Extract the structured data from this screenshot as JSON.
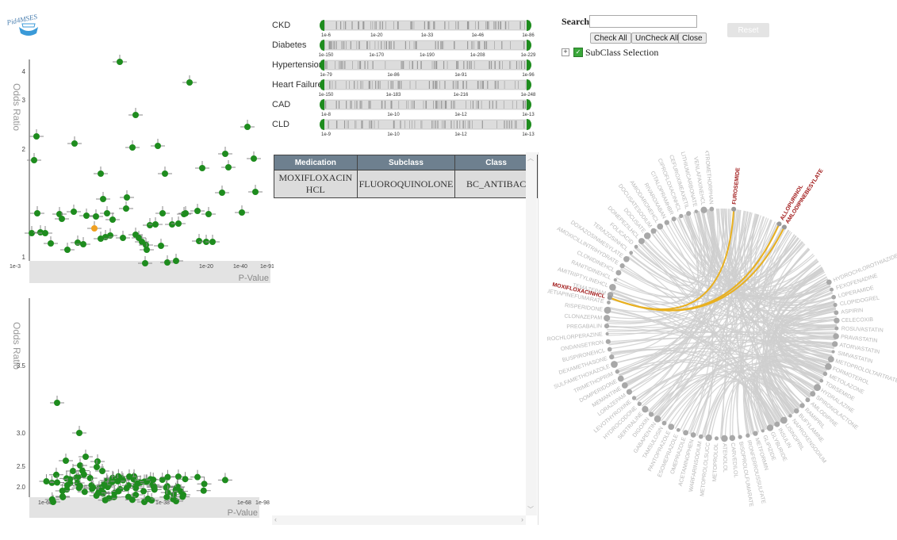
{
  "app": {
    "logo_text": "Pid4MSES"
  },
  "scatter_top": {
    "y_title": "Odds Ratio",
    "x_title": "P-Value",
    "y_ticks": [
      "4",
      "3",
      "2",
      "1"
    ],
    "x_ticks": [
      "1e-3",
      "1e-20",
      "1e-40",
      "1e-91"
    ]
  },
  "scatter_bottom": {
    "y_title": "Odds Ratio",
    "x_title": "P-Value",
    "y_ticks": [
      "3.5",
      "3.0",
      "2.5",
      "2.0"
    ],
    "x_ticks": [
      "1e-68",
      "1e-38",
      "1e-68",
      "1e-98"
    ]
  },
  "filters": [
    {
      "label": "CKD",
      "ticks": [
        "1e-6",
        "1e-20",
        "1e-33",
        "1e-46",
        "1e-86"
      ]
    },
    {
      "label": "Diabetes",
      "ticks": [
        "1e-150",
        "1e-170",
        "1e-190",
        "1e-208",
        "1e-229"
      ]
    },
    {
      "label": "Hypertension",
      "ticks": [
        "1e-79",
        "1e-86",
        "1e-91",
        "1e-96"
      ]
    },
    {
      "label": "Heart Failure",
      "ticks": [
        "1e-150",
        "1e-183",
        "1e-216",
        "1e-248"
      ]
    },
    {
      "label": "CAD",
      "ticks": [
        "1e-8",
        "1e-10",
        "1e-12",
        "1e-13"
      ]
    },
    {
      "label": "CLD",
      "ticks": [
        "1e-9",
        "1e-10",
        "1e-12",
        "1e-13"
      ]
    }
  ],
  "table": {
    "headers": [
      "Medication",
      "Subclass",
      "Class"
    ],
    "rows": [
      [
        "MOXIFLOXACIN HCL",
        "FLUOROQUINOLONE",
        "BC_ANTIBAC"
      ]
    ]
  },
  "search": {
    "label": "Search:",
    "value": "",
    "check_all": "Check All",
    "uncheck_all": "UnCheck All",
    "close": "Close",
    "reset": "Reset",
    "tree_label": "SubClass Selection"
  },
  "network": {
    "highlighted": [
      "FUROSEMIDE",
      "ALLOPURINOL",
      "AMLODIPINEBESYLATE",
      "MOXIFLOXACINHCL"
    ],
    "labels": [
      "DEXTROMETHORPHAN",
      "VENLAFAXINEHCL",
      "LITHIUMCARBONATE",
      "CEFUROXIMEAXETIL",
      "CIPROFLOXACINHCL",
      "CITALOPRAMHBR",
      "RIVAROXABAN",
      "AMIODARONEHCL",
      "DOCUSATESODIUM",
      "DOCUSATE",
      "DONEPEZILHCL",
      "FOLICACID",
      "TERAZOSINHCL",
      "DOXAZOSINMESYLATE",
      "AMOXICILLINTRIHYDRATE",
      "CLONIDINEHCL",
      "RANITIDINEHCL",
      "AMITRIPTYLINEHCL",
      "TEMAZEPAM",
      "QUETIAPINEFUMARATE",
      "RISPERIDONE",
      "CLONAZEPAM",
      "PREGABALIN",
      "PROCHLORPERAZINE",
      "ONDANSETRON",
      "BUSPIRONEHCL",
      "DEXAMETHASONE",
      "SULFAMETHOXAZOLE",
      "TRIMETHOPRIM",
      "DOMPERIDONE",
      "MEMANTINE",
      "LORAZEPAM",
      "LEVOTHYROXINE",
      "HYDROCODONE",
      "SERTRALINE",
      "DIGOXIN",
      "GABAPENTIN",
      "TAMSULOSIN",
      "PANTOPRAZOLE",
      "ESOMEPRAZOLE",
      "OMEPRAZOLE",
      "ACETAMINOPHEN",
      "WARFARINSODIUM",
      "METOPROLOLSUCC",
      "METOPROLOL",
      "ATENOLOL",
      "CARVEDILOL",
      "BISOPROLOLFUMARATE",
      "IRONFERROUSSULFATE",
      "METFORMIN",
      "GLIPIZIDE",
      "GLYBURIDE",
      "INSULIN",
      "LISINOPRIL",
      "NAPROXENSODIUM",
      "BUFYLAMINE",
      "RAMIPRIL",
      "AMLODIPINE",
      "SPIRONOLACTONE",
      "HYDRALAZINE",
      "TORSEMIDE",
      "METOLAZONE",
      "FORMOTEROL",
      "METOPROLOLTARTRATE",
      "SIMVASTATIN",
      "ATORVASTATIN",
      "PRAVASTATIN",
      "ROSUVASTATIN",
      "CELECOXIB",
      "ASPIRIN",
      "CLOPIDOGREL",
      "LOPERAMIDE",
      "FEXOFENADINE",
      "HYDROCHLOROTHIAZIDE"
    ]
  },
  "colors": {
    "point": "#1e8c1e",
    "selected": "#f0a020",
    "highlight_link": "#e8b020",
    "link": "#cfcfcf",
    "highlight_text": "#a01818",
    "header": "#6e808f"
  }
}
